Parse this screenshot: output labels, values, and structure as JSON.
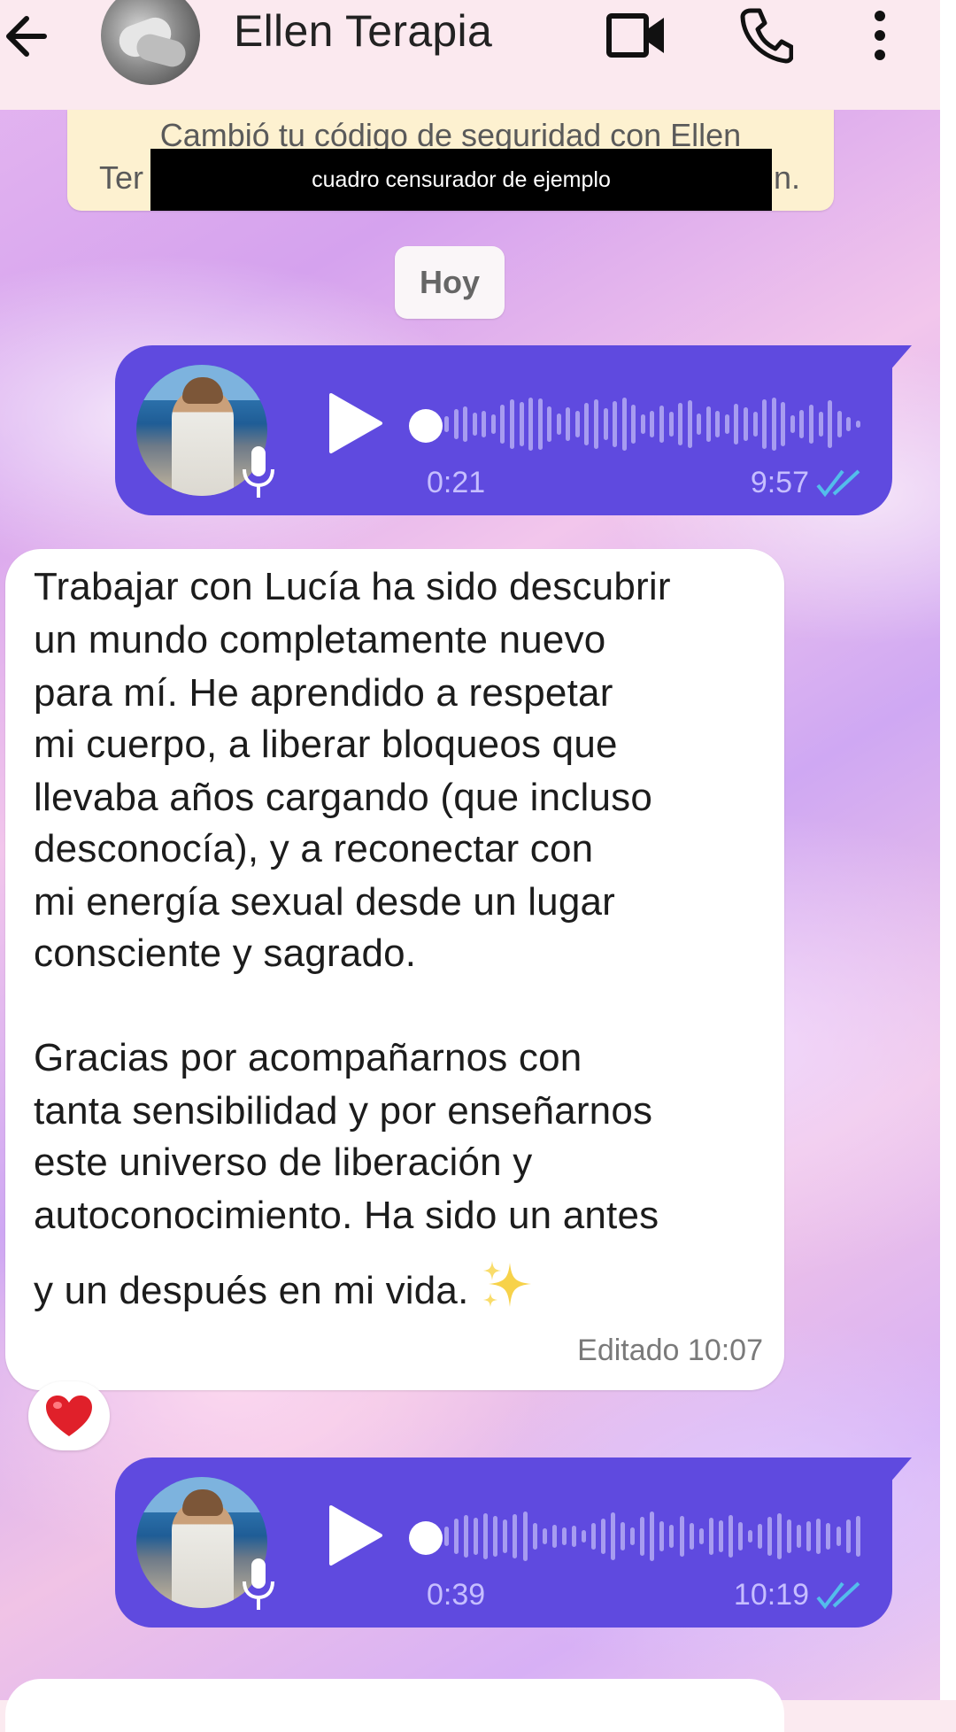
{
  "header": {
    "contact_name": "Ellen Terapia",
    "icons": [
      "back-arrow-icon",
      "contact-avatar",
      "video-camera-icon",
      "phone-icon",
      "more-vert-icon"
    ]
  },
  "security_notice": {
    "line1": "Cambió tu código de seguridad con Ellen",
    "line2_start": "Ter",
    "line2_end": "n.",
    "censor_label": "cuadro censurador de ejemplo"
  },
  "date_separator": "Hoy",
  "messages": [
    {
      "type": "voice",
      "direction": "outgoing",
      "duration": "0:21",
      "time": "9:57",
      "status": "read"
    },
    {
      "type": "text",
      "direction": "incoming",
      "lines": [
        "Trabajar con Lucía ha sido descubrir",
        "un mundo completamente nuevo",
        "para mí. He aprendido a respetar",
        "mi cuerpo, a liberar bloqueos que",
        "llevaba años cargando (que incluso",
        "desconocía), y a reconectar con",
        "mi energía sexual desde un lugar",
        "consciente y sagrado.",
        "",
        "Gracias por acompañarnos con",
        "tanta sensibilidad y por enseñarnos",
        "este universo de liberación y",
        "autoconocimiento. Ha sido un antes",
        "y un después en mi vida."
      ],
      "emoji": "sparkles-emoji",
      "footer": "Editado 10:07",
      "reaction": "❤️"
    },
    {
      "type": "voice",
      "direction": "outgoing",
      "duration": "0:39",
      "time": "10:19",
      "status": "read"
    }
  ],
  "colors": {
    "header_bg": "#fbe9ef",
    "voice_bubble": "#5f4adf",
    "voice_meta_text": "#c6beff",
    "read_checks": "#53bdeb",
    "security_bg": "#fdf1d0"
  }
}
